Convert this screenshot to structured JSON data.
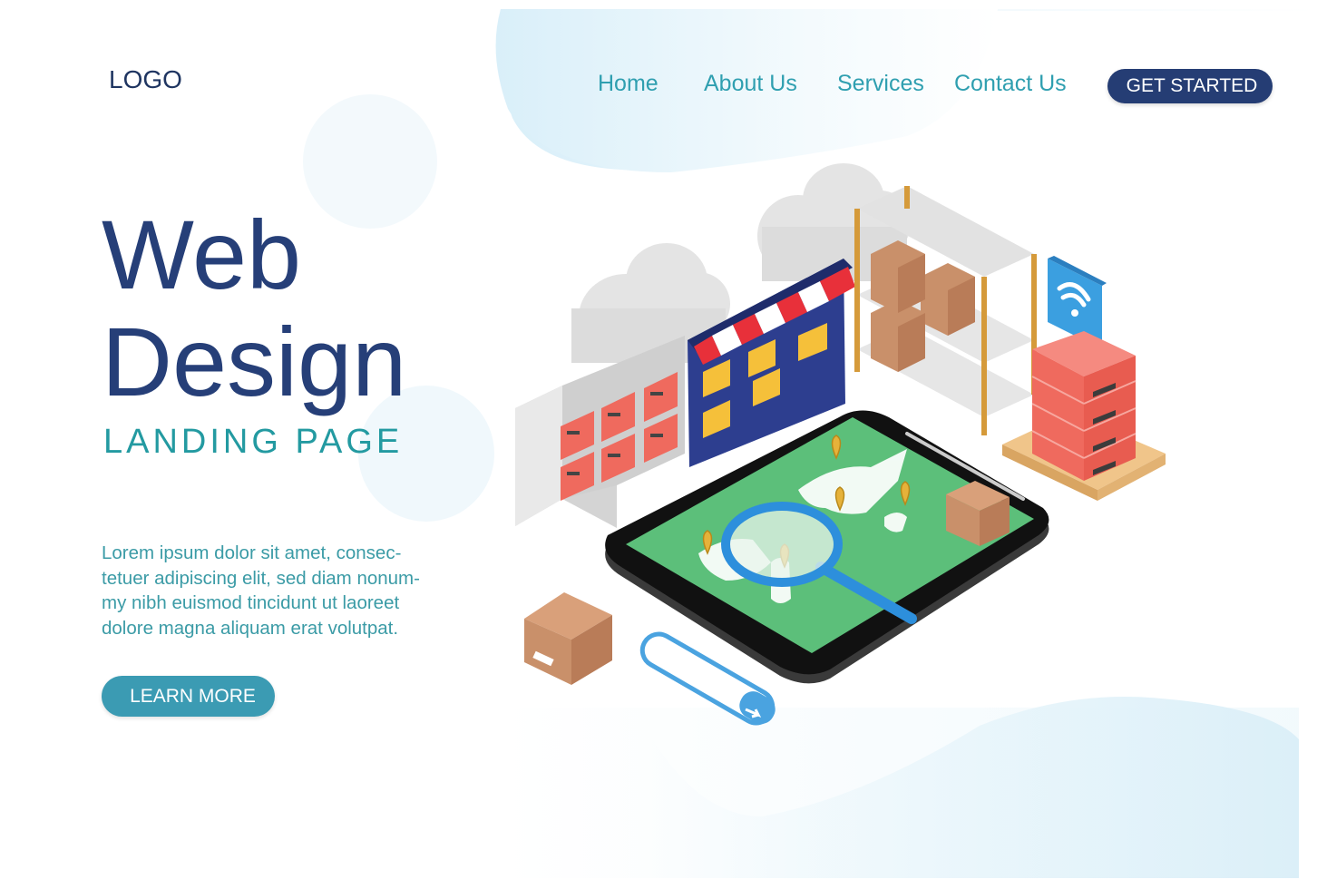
{
  "header": {
    "logo": "LOGO",
    "nav": [
      {
        "label": "Home"
      },
      {
        "label": "About Us"
      },
      {
        "label": "Services"
      },
      {
        "label": "Contact Us"
      }
    ],
    "cta_label": "GET STARTED"
  },
  "hero": {
    "title_line1": "Web",
    "title_line2": "Design",
    "subtitle": "LANDING PAGE",
    "description_lines": [
      "Lorem ipsum dolor sit amet, consec-",
      "tetuer adipiscing elit, sed diam nonum-",
      "my nibh euismod tincidunt ut laoreet",
      "dolore magna aliquam erat volutpat."
    ],
    "learn_more_label": "LEARN MORE"
  },
  "colors": {
    "navy": "#263f78",
    "teal": "#2f9fb0",
    "button_teal": "#3b9bb3",
    "blob_blue": "#dcf0f9",
    "box_red": "#ef6a5e",
    "cardboard": "#c9906a",
    "map_green": "#5cbf7a",
    "magnifier_blue": "#2d8fdc"
  },
  "illustration": {
    "description": "isometric e-commerce / logistics scene",
    "elements": [
      "cloud-icon",
      "server-rack",
      "storefront-screen",
      "shelf-with-boxes",
      "wifi-icon",
      "pallet-boxes",
      "tablet-world-map",
      "location-pin-icon",
      "magnifier-icon",
      "cardboard-box",
      "search-bar"
    ]
  }
}
